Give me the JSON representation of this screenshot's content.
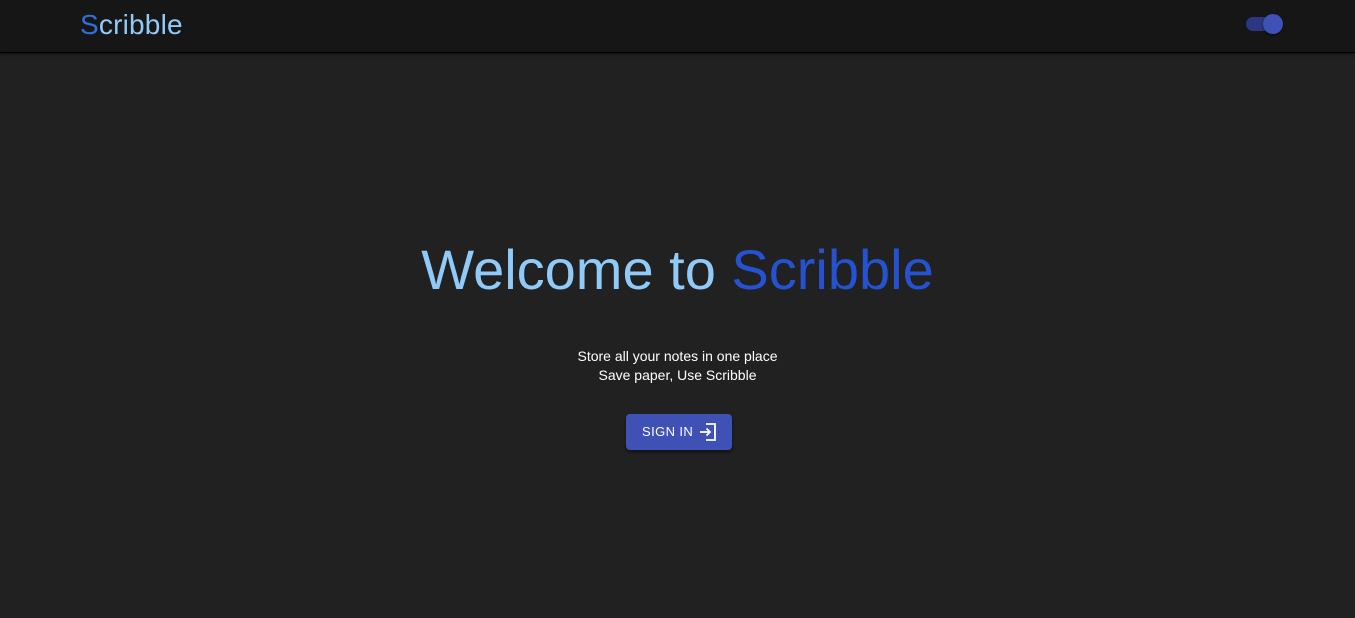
{
  "header": {
    "logo_first": "S",
    "logo_rest": "cribble",
    "theme_toggle": {
      "state": "on"
    }
  },
  "hero": {
    "title_part1": "Welcome to ",
    "title_part2": "Scribble",
    "line1": "Store all your notes in one place",
    "line2": "Save paper, Use Scribble"
  },
  "signin": {
    "label": "SIGN IN",
    "icon": "login-icon"
  },
  "colors": {
    "background": "#212121",
    "appbar": "#161616",
    "light_blue": "#90caf9",
    "blue": "#2452d1",
    "primary": "#3f51b5"
  }
}
